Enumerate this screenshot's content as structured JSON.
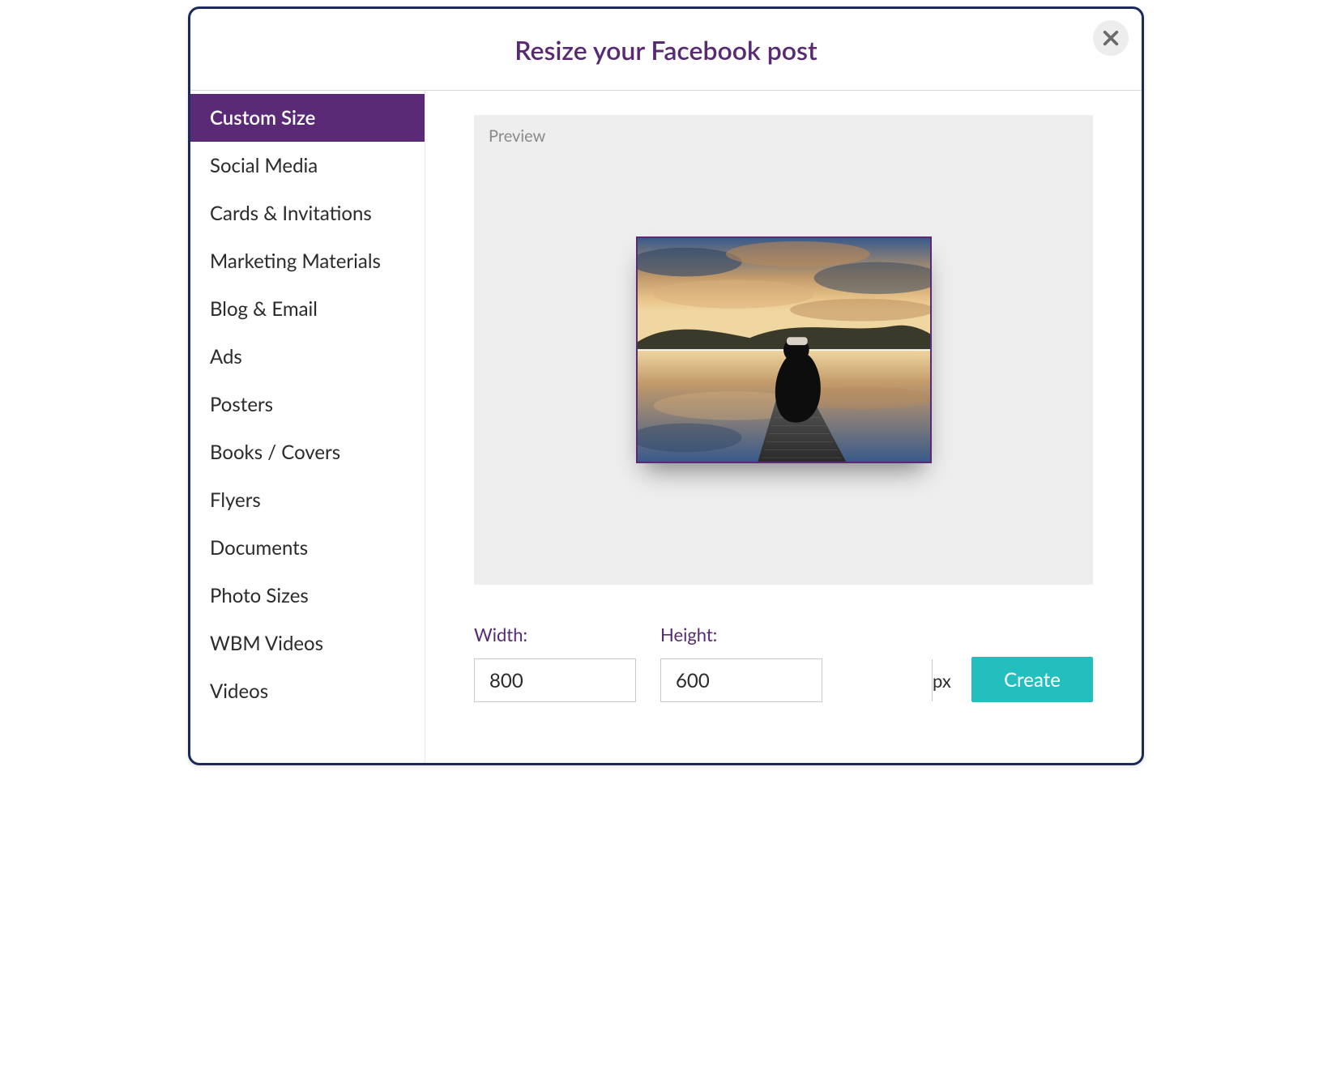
{
  "header": {
    "title": "Resize your Facebook post"
  },
  "sidebar": {
    "items": [
      {
        "label": "Custom Size",
        "active": true
      },
      {
        "label": "Social Media"
      },
      {
        "label": "Cards & Invitations"
      },
      {
        "label": "Marketing Materials"
      },
      {
        "label": "Blog & Email"
      },
      {
        "label": "Ads"
      },
      {
        "label": "Posters"
      },
      {
        "label": "Books / Covers"
      },
      {
        "label": "Flyers"
      },
      {
        "label": "Documents"
      },
      {
        "label": "Photo Sizes"
      },
      {
        "label": "WBM Videos"
      },
      {
        "label": "Videos"
      }
    ]
  },
  "preview": {
    "label": "Preview"
  },
  "form": {
    "width_label": "Width:",
    "height_label": "Height:",
    "width_value": "800",
    "height_value": "600",
    "unit": "px",
    "create_label": "Create"
  }
}
